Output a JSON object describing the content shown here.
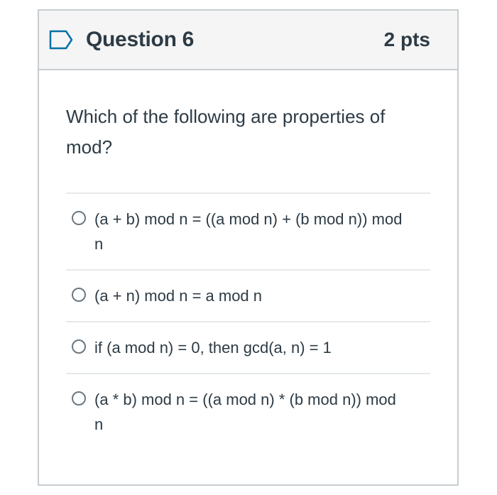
{
  "question": {
    "title": "Question 6",
    "points": "2 pts",
    "text": "Which of the following are properties of mod?"
  },
  "answers": [
    {
      "label": "(a + b) mod n = ((a mod n) + (b mod n)) mod n",
      "selected": false
    },
    {
      "label": "(a + n) mod n = a mod n",
      "selected": false
    },
    {
      "label": "if (a mod n) = 0, then gcd(a, n) = 1",
      "selected": false
    },
    {
      "label": "(a * b) mod n = ((a mod n) * (b mod n)) mod n",
      "selected": false
    }
  ],
  "colors": {
    "text": "#2d3b45",
    "header_bg": "#f5f5f5",
    "border": "#c7cdd1",
    "flag": "#0770a3"
  }
}
